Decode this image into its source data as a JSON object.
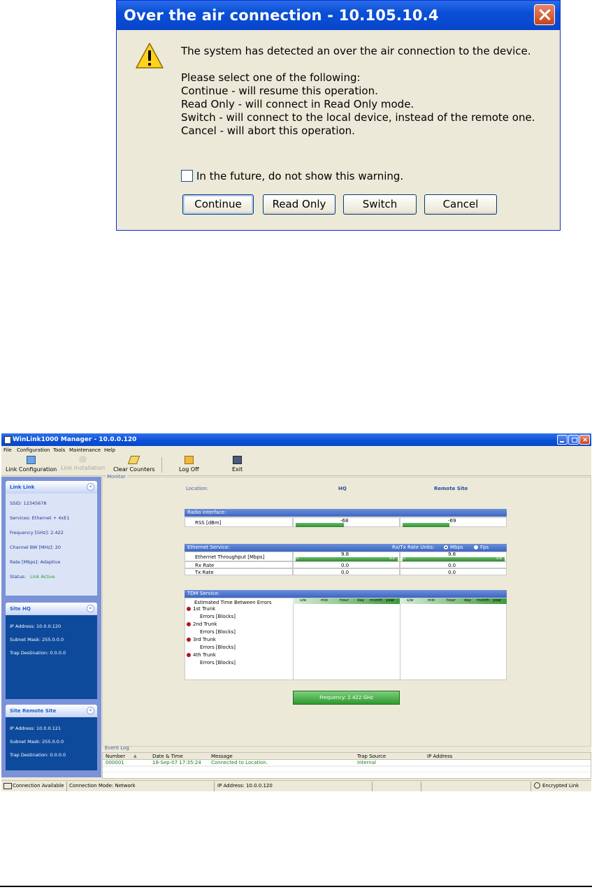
{
  "dialog": {
    "title": "Over the air connection - 10.105.10.4",
    "line1": "The system has detected an over the air connection to the device.",
    "line2": "Please select one of the following:",
    "line3": "Continue - will resume this operation.",
    "line4": "Read Only - will connect in Read Only mode.",
    "line5": "Switch - will connect to the local device, instead of the remote one.",
    "line6": "Cancel - will abort this operation.",
    "checkbox_label": "In the future, do not show this warning.",
    "buttons": {
      "continue": "Continue",
      "read_only": "Read Only",
      "switch": "Switch",
      "cancel": "Cancel"
    }
  },
  "app": {
    "title": "WinLink1000 Manager - 10.0.0.120",
    "menu": [
      "File",
      "Configuration",
      "Tools",
      "Maintenance",
      "Help"
    ],
    "toolbar": {
      "link_configuration": "Link Configuration",
      "link_installation": "Link Installation",
      "clear_counters": "Clear Counters",
      "log_off": "Log Off",
      "exit": "Exit"
    },
    "link_panel": {
      "title": "Link Link",
      "ssid": "SSID:  12345678",
      "services": "Services:  Ethernet + 4xE1",
      "frequency": "Frequency [GHz]:  2.422",
      "channel_bw": "Channel BW [MHz]:  20",
      "rate": "Rate [Mbps]:  Adaptive",
      "status_label": "Status:",
      "status_value": "Link Active"
    },
    "site_hq": {
      "title": "Site HQ",
      "ip": "IP Address:  10.0.0.120",
      "mask": "Subnet Mask:  255.0.0.0",
      "trap": "Trap Destination:  0.0.0.0"
    },
    "site_remote": {
      "title": "Site Remote Site",
      "ip": "IP Address:  10.0.0.121",
      "mask": "Subnet Mask:  255.0.0.0",
      "trap": "Trap Destination:  0.0.0.0"
    },
    "monitor": {
      "group": "Monitor",
      "location_label": "Location:",
      "hq": "HQ",
      "remote": "Remote Site",
      "radio_header": "Radio Interface:",
      "rss_label": "RSS [dBm]",
      "rss_hq": "-68",
      "rss_remote": "-69",
      "rss_hq_fill": 0.47,
      "rss_remote_fill": 0.46,
      "eth_header": "Ethernet Service:",
      "rate_units_label": "Rx/Tx Rate Units:",
      "unit_mbps": "Mbps",
      "unit_fps": "Fps",
      "eth_throughput_label": "Ethernet Throughput [Mbps]",
      "eth_hq": "9.8",
      "eth_remote": "9.8",
      "scale_min": "0",
      "scale_max": "9.8",
      "rx_label": "Rx Rate",
      "tx_label": "Tx Rate",
      "rx_hq": "0.0",
      "rx_remote": "0.0",
      "tx_hq": "0.0",
      "tx_remote": "0.0",
      "tdm_header": "TDM Service:",
      "tdm_etbe": "Estimated Time Between Errors",
      "tdm_scale": [
        "s/w",
        "min",
        "hour",
        "day",
        "month",
        "year"
      ],
      "trunks": [
        "1st Trunk",
        "2nd Trunk",
        "3rd Trunk",
        "4th Trunk"
      ],
      "errors_label": "Errors [Blocks]",
      "frequency_button": "Frequency: 2.422 GHz"
    },
    "event_log": {
      "group": "Event Log",
      "columns": [
        "Number",
        "Date & Time",
        "Message",
        "Trap Source",
        "IP Address"
      ],
      "rows": [
        [
          "000001",
          "18-Sep-07 17:35:24",
          "Connected to Location.",
          "Internal",
          ""
        ]
      ]
    },
    "statusbar": {
      "connection": "Connection Available",
      "mode": "Connection Mode: Network",
      "ip": "IP Address: 10.0.0.120",
      "encrypted": "Encrypted Link"
    }
  }
}
